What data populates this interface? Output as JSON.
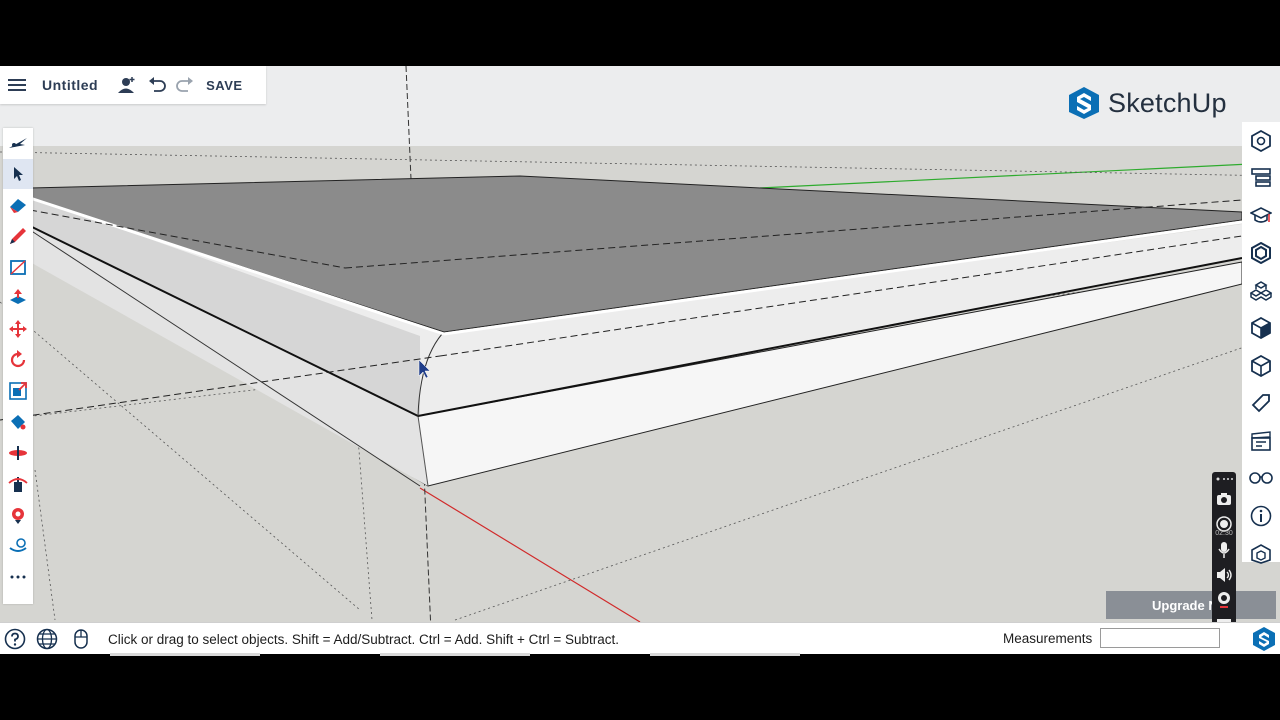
{
  "header": {
    "title": "Untitled",
    "save_label": "SAVE",
    "brand": "SketchUp"
  },
  "toolbar_left": {
    "tools": [
      "search-icon",
      "select-icon",
      "eraser-icon",
      "pencil-icon",
      "rectangle-icon",
      "push-pull-icon",
      "move-icon",
      "rotate-icon",
      "scale-icon",
      "paint-bucket-icon",
      "section-plane-icon",
      "orbit-icon",
      "position-camera-icon",
      "tape-measure-icon",
      "more-icon"
    ]
  },
  "toolbar_right": {
    "tools": [
      "entity-info-icon",
      "outliner-icon",
      "instructor-icon",
      "components-icon",
      "materials-icon",
      "styles-icon",
      "scenes-icon",
      "tags-icon",
      "soften-edges-icon",
      "display-icon",
      "info-icon",
      "3d-warehouse-icon"
    ]
  },
  "recorder": {
    "time": "02:30"
  },
  "upgrade": {
    "label": "Upgrade N"
  },
  "status": {
    "hint": "Click or drag to select objects. Shift = Add/Subtract. Ctrl = Add. Shift + Ctrl = Subtract.",
    "measurements_label": "Measurements",
    "measurements_value": ""
  },
  "colors": {
    "accent": "#0b6fb5",
    "red_axis": "#d12a2a",
    "green_axis": "#2eab2e",
    "top_face": "#8b8b8b"
  }
}
